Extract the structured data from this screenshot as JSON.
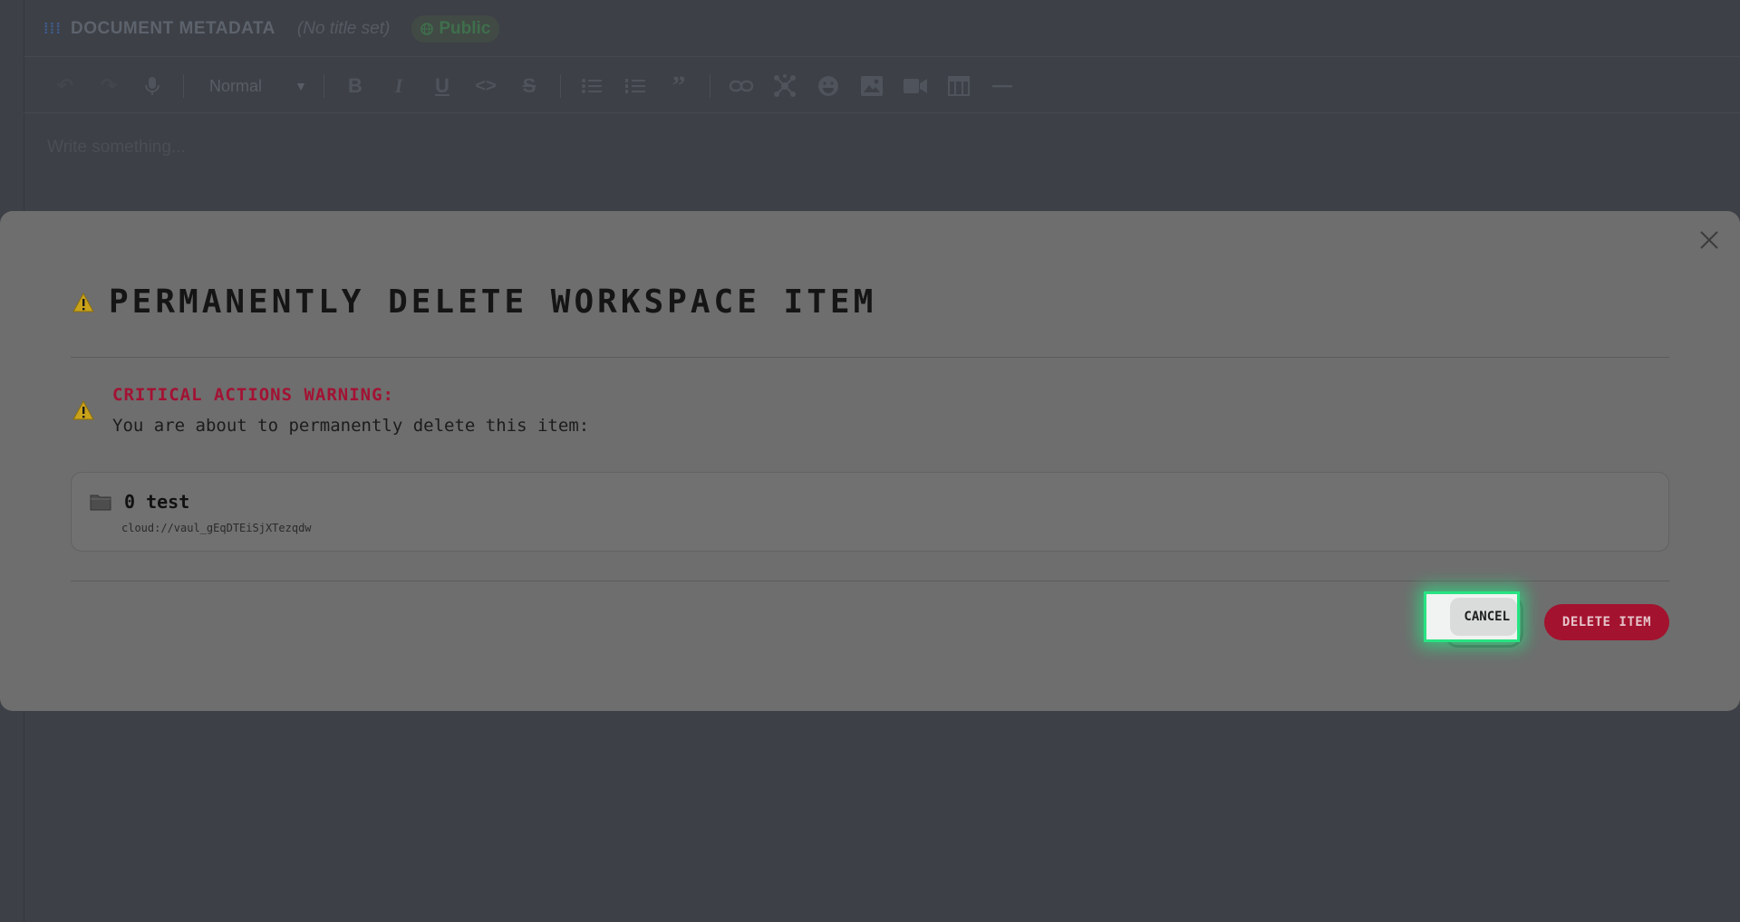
{
  "header": {
    "section_title": "DOCUMENT METADATA",
    "doc_title_placeholder": "(No title set)",
    "visibility_badge": "Public"
  },
  "toolbar": {
    "block_style": "Normal",
    "buttons": [
      "undo-icon",
      "redo-icon",
      "microphone-icon",
      "bold-icon",
      "italic-icon",
      "underline-icon",
      "code-icon",
      "strikethrough-icon",
      "bullet-list-icon",
      "numbered-list-icon",
      "quote-icon",
      "link-icon",
      "network-icon",
      "emoji-icon",
      "image-icon",
      "video-icon",
      "table-icon",
      "horizontal-rule-icon"
    ]
  },
  "editor": {
    "placeholder": "Write something..."
  },
  "modal": {
    "title": "PERMANENTLY DELETE WORKSPACE ITEM",
    "warning_heading": "CRITICAL ACTIONS WARNING:",
    "warning_body": "You are about to permanently delete this item:",
    "item": {
      "name": "0 test",
      "path": "cloud://vaul_gEqDTEiSjXTezqdw"
    },
    "cancel_label": "CANCEL",
    "delete_label": "DELETE ITEM"
  },
  "colors": {
    "overlay": "#3d4046",
    "modal_bg": "#6e6e6e",
    "danger": "#a3122e",
    "focus_ring": "#28e382",
    "warning_yellow": "#c9a21a"
  }
}
